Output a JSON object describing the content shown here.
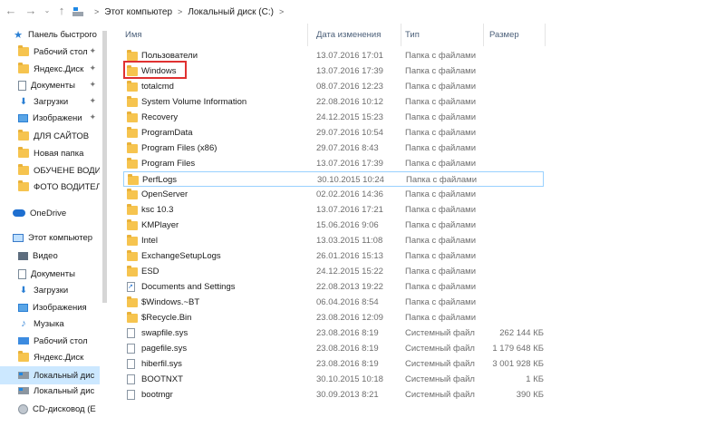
{
  "nav": {
    "back_icon": "back-arrow-icon",
    "forward_icon": "forward-arrow-icon",
    "history_icon": "chevron-down-icon",
    "up_icon": "up-arrow-icon"
  },
  "address": {
    "breadcrumbs": [
      "Этот компьютер",
      "Локальный диск (C:)"
    ],
    "separator": ">"
  },
  "sidebar": {
    "items": [
      {
        "label": "Панель быстрого",
        "icon": "star-icon"
      },
      {
        "label": "Рабочий стол",
        "icon": "folder-icon",
        "pinned": true
      },
      {
        "label": "Яндекс.Диск",
        "icon": "folder-icon",
        "pinned": true
      },
      {
        "label": "Документы",
        "icon": "documents-icon",
        "pinned": true
      },
      {
        "label": "Загрузки",
        "icon": "download-icon",
        "pinned": true
      },
      {
        "label": "Изображени",
        "icon": "pictures-icon",
        "pinned": true
      },
      {
        "label": "ДЛЯ САЙТОВ",
        "icon": "folder-icon"
      },
      {
        "label": "Новая папка",
        "icon": "folder-icon"
      },
      {
        "label": "ОБУЧЕНЕ ВОДИ",
        "icon": "folder-icon"
      },
      {
        "label": "ФОТО ВОДИТЕЛ",
        "icon": "folder-icon"
      },
      {
        "label": "OneDrive",
        "icon": "cloud-icon"
      },
      {
        "label": "Этот компьютер",
        "icon": "computer-icon"
      },
      {
        "label": "Видео",
        "icon": "video-icon"
      },
      {
        "label": "Документы",
        "icon": "documents-icon"
      },
      {
        "label": "Загрузки",
        "icon": "download-icon"
      },
      {
        "label": "Изображения",
        "icon": "pictures-icon"
      },
      {
        "label": "Музыка",
        "icon": "music-icon"
      },
      {
        "label": "Рабочий стол",
        "icon": "desktop-icon"
      },
      {
        "label": "Яндекс.Диск",
        "icon": "folder-icon"
      },
      {
        "label": "Локальный дис",
        "icon": "drive-icon",
        "selected": true
      },
      {
        "label": "Локальный дис",
        "icon": "drive-icon"
      },
      {
        "label": "CD-дисковод (E",
        "icon": "cd-icon"
      }
    ]
  },
  "columns": {
    "name": "Имя",
    "date": "Дата изменения",
    "type": "Тип",
    "size": "Размер"
  },
  "files": [
    {
      "name": "Пользователи",
      "date": "13.07.2016 17:01",
      "type": "Папка с файлами",
      "size": "",
      "icon": "folder-icon"
    },
    {
      "name": "Windows",
      "date": "13.07.2016 17:39",
      "type": "Папка с файлами",
      "size": "",
      "icon": "folder-icon",
      "highlighted": true
    },
    {
      "name": "totalcmd",
      "date": "08.07.2016 12:23",
      "type": "Папка с файлами",
      "size": "",
      "icon": "folder-icon"
    },
    {
      "name": "System Volume Information",
      "date": "22.08.2016 10:12",
      "type": "Папка с файлами",
      "size": "",
      "icon": "folder-icon"
    },
    {
      "name": "Recovery",
      "date": "24.12.2015 15:23",
      "type": "Папка с файлами",
      "size": "",
      "icon": "folder-icon"
    },
    {
      "name": "ProgramData",
      "date": "29.07.2016 10:54",
      "type": "Папка с файлами",
      "size": "",
      "icon": "folder-icon"
    },
    {
      "name": "Program Files (x86)",
      "date": "29.07.2016 8:43",
      "type": "Папка с файлами",
      "size": "",
      "icon": "folder-icon"
    },
    {
      "name": "Program Files",
      "date": "13.07.2016 17:39",
      "type": "Папка с файлами",
      "size": "",
      "icon": "folder-icon"
    },
    {
      "name": "PerfLogs",
      "date": "30.10.2015 10:24",
      "type": "Папка с файлами",
      "size": "",
      "icon": "folder-icon",
      "hover": true
    },
    {
      "name": "OpenServer",
      "date": "02.02.2016 14:36",
      "type": "Папка с файлами",
      "size": "",
      "icon": "folder-icon"
    },
    {
      "name": "ksc 10.3",
      "date": "13.07.2016 17:21",
      "type": "Папка с файлами",
      "size": "",
      "icon": "folder-icon"
    },
    {
      "name": "KMPlayer",
      "date": "15.06.2016 9:06",
      "type": "Папка с файлами",
      "size": "",
      "icon": "folder-icon"
    },
    {
      "name": "Intel",
      "date": "13.03.2015 11:08",
      "type": "Папка с файлами",
      "size": "",
      "icon": "folder-icon"
    },
    {
      "name": "ExchangeSetupLogs",
      "date": "26.01.2016 15:13",
      "type": "Папка с файлами",
      "size": "",
      "icon": "folder-icon"
    },
    {
      "name": "ESD",
      "date": "24.12.2015 15:22",
      "type": "Папка с файлами",
      "size": "",
      "icon": "folder-icon"
    },
    {
      "name": "Documents and Settings",
      "date": "22.08.2013 19:22",
      "type": "Папка с файлами",
      "size": "",
      "icon": "shortcut-folder-icon"
    },
    {
      "name": "$Windows.~BT",
      "date": "06.04.2016 8:54",
      "type": "Папка с файлами",
      "size": "",
      "icon": "folder-icon"
    },
    {
      "name": "$Recycle.Bin",
      "date": "23.08.2016 12:09",
      "type": "Папка с файлами",
      "size": "",
      "icon": "folder-icon"
    },
    {
      "name": "swapfile.sys",
      "date": "23.08.2016 8:19",
      "type": "Системный файл",
      "size": "262 144 КБ",
      "icon": "file-icon"
    },
    {
      "name": "pagefile.sys",
      "date": "23.08.2016 8:19",
      "type": "Системный файл",
      "size": "1 179 648 КБ",
      "icon": "file-icon"
    },
    {
      "name": "hiberfil.sys",
      "date": "23.08.2016 8:19",
      "type": "Системный файл",
      "size": "3 001 928 КБ",
      "icon": "file-icon"
    },
    {
      "name": "BOOTNXT",
      "date": "30.10.2015 10:18",
      "type": "Системный файл",
      "size": "1 КБ",
      "icon": "file-icon"
    },
    {
      "name": "bootmgr",
      "date": "30.09.2013 8:21",
      "type": "Системный файл",
      "size": "390 КБ",
      "icon": "file-icon"
    }
  ],
  "colors": {
    "selected_bg": "#cce8ff",
    "hover_border": "#99d1ff",
    "highlight_border": "#e03131",
    "folder": "#f6c44f",
    "header_text": "#4c607a"
  }
}
